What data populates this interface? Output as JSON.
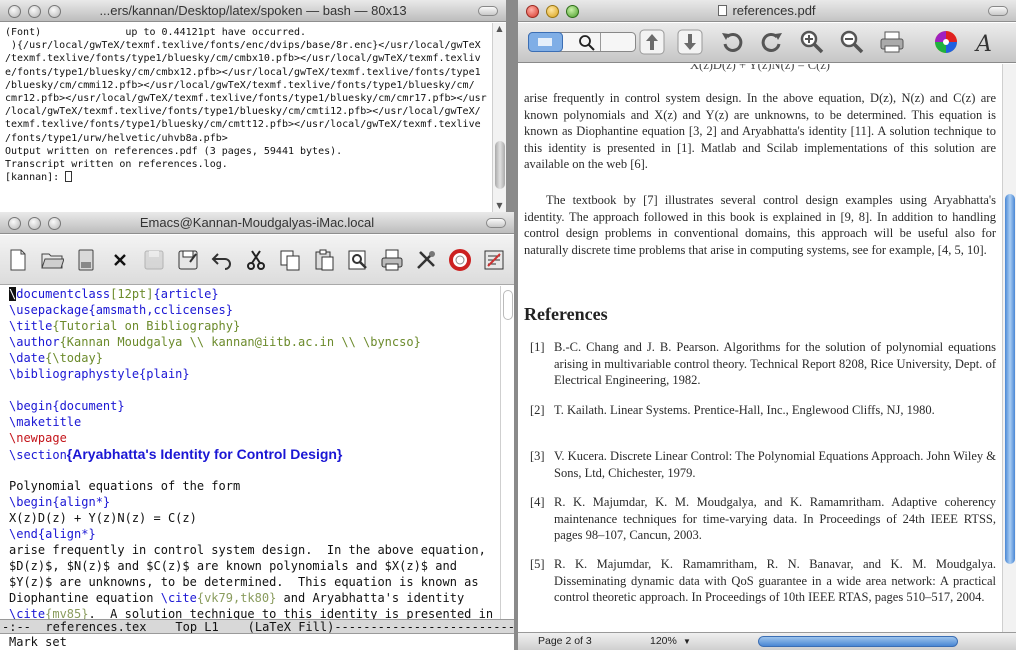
{
  "terminal": {
    "title": "...ers/kannan/Desktop/latex/spoken — bash — 80x13",
    "lines": [
      "(Font)              up to 0.44121pt have occurred.",
      "",
      " ){/usr/local/gwTeX/texmf.texlive/fonts/enc/dvips/base/8r.enc}</usr/local/gwTeX",
      "/texmf.texlive/fonts/type1/bluesky/cm/cmbx10.pfb></usr/local/gwTeX/texmf.texliv",
      "e/fonts/type1/bluesky/cm/cmbx12.pfb></usr/local/gwTeX/texmf.texlive/fonts/type1",
      "/bluesky/cm/cmmi12.pfb></usr/local/gwTeX/texmf.texlive/fonts/type1/bluesky/cm/",
      "cmr12.pfb></usr/local/gwTeX/texmf.texlive/fonts/type1/bluesky/cm/cmr17.pfb></usr",
      "/local/gwTeX/texmf.texlive/fonts/type1/bluesky/cm/cmti12.pfb></usr/local/gwTeX/",
      "texmf.texlive/fonts/type1/bluesky/cm/cmtt12.pfb></usr/local/gwTeX/texmf.texlive",
      "/fonts/type1/urw/helvetic/uhvb8a.pfb>",
      "Output written on references.pdf (3 pages, 59441 bytes).",
      "Transcript written on references.log.",
      "[kannan]: "
    ]
  },
  "emacs": {
    "title": "Emacs@Kannan-Moudgalyas-iMac.local",
    "toolbar": [
      "new-file",
      "open-folder",
      "save-disk",
      "close",
      "save-dim",
      "save-as",
      "undo",
      "cut",
      "copy",
      "paste",
      "search",
      "print",
      "preferences",
      "help",
      "info"
    ],
    "editor": {
      "documentclass": "\\documentclass",
      "docclass_opt": "[12pt]",
      "docclass_arg": "{article}",
      "usepackage": "\\usepackage",
      "usepackage_arg": "{amsmath,cclicenses}",
      "title_cmd": "\\title",
      "title_arg": "{Tutorial on Bibliography}",
      "author_cmd": "\\author",
      "author_arg": "{Kannan Moudgalya \\\\ kannan@iitb.ac.in \\\\ \\byncso}",
      "date_cmd": "\\date",
      "date_arg": "{\\today}",
      "bibstyle_cmd": "\\bibliographystyle",
      "bibstyle_arg": "{plain}",
      "begin_doc": "\\begin",
      "begin_doc_arg": "{document}",
      "maketitle": "\\maketitle",
      "newpage": "\\newpage",
      "section_cmd": "\\section",
      "section_arg": "{Aryabhatta's Identity for Control Design}",
      "poly": "Polynomial equations of the form",
      "begin_align": "\\begin",
      "begin_align_arg": "{align*}",
      "eq": "X(z)D(z) + Y(z)N(z) = C(z)",
      "end_align": "\\end",
      "end_align_arg": "{align*}",
      "l1": "arise frequently in control system design.  In the above equation,",
      "l2": "$D(z)$, $N(z)$ and $C(z)$ are known polynomials and $X(z)$ and",
      "l3": "$Y(z)$ are unknowns, to be determined.  This equation is known as",
      "l4a": "Diophantine equation ",
      "l4cite": "\\cite",
      "l4arg": "{vk79,tk80}",
      "l4b": " and Aryabhatta's identity",
      "l5cite": "\\cite",
      "l5arg": "{mv85}",
      "l5b": ".  A solution technique to this identity is presented in"
    },
    "modeline": "-:--  references.tex    Top L1    (LaTeX Fill)-------------------------------",
    "minibuffer": "Mark set"
  },
  "preview": {
    "title": "references.pdf",
    "top_eq": "X(z)D(z) + Y(z)N(z) = C(z)",
    "para1": "arise frequently in control system design. In the above equation, D(z), N(z) and C(z) are known polynomials and X(z) and Y(z) are unknowns, to be determined. This equation is known as Diophantine equation [3, 2] and Aryabhatta's identity [11]. A solution technique to this identity is presented in [1]. Matlab and Scilab implementations of this solution are available on the web [6].",
    "para2": "The textbook by [7] illustrates several control design examples using Aryabhatta's identity. The approach followed in this book is explained in [9, 8]. In addition to handling control design problems in conventional domains, this approach will be useful also for naturally discrete time problems that arise in computing systems, see for example, [4, 5, 10].",
    "refs_heading": "References",
    "refs": [
      {
        "num": "[1]",
        "text": "B.-C. Chang and J. B. Pearson. Algorithms for the solution of polynomial equations arising in multivariable control theory. Technical Report 8208, Rice University, Dept. of Electrical Engineering, 1982."
      },
      {
        "num": "[2]",
        "text": "T. Kailath. Linear Systems. Prentice-Hall, Inc., Englewood Cliffs, NJ, 1980."
      },
      {
        "num": "[3]",
        "text": "V. Kucera. Discrete Linear Control: The Polynomial Equations Approach. John Wiley & Sons, Ltd, Chichester, 1979."
      },
      {
        "num": "[4]",
        "text": "R. K. Majumdar, K. M. Moudgalya, and K. Ramamritham. Adaptive coherency maintenance techniques for time-varying data. In Proceedings of 24th IEEE RTSS, pages 98–107, Cancun, 2003."
      },
      {
        "num": "[5]",
        "text": "R. K. Majumdar, K. Ramamritham, R. N. Banavar, and K. M. Moudgalya. Disseminating dynamic data with QoS guarantee in a wide area network: A practical control theoretic approach. In Proceedings of 10th IEEE RTAS, pages 510–517, 2004."
      }
    ],
    "status": {
      "page": "Page 2 of 3",
      "zoom": "120%"
    }
  }
}
